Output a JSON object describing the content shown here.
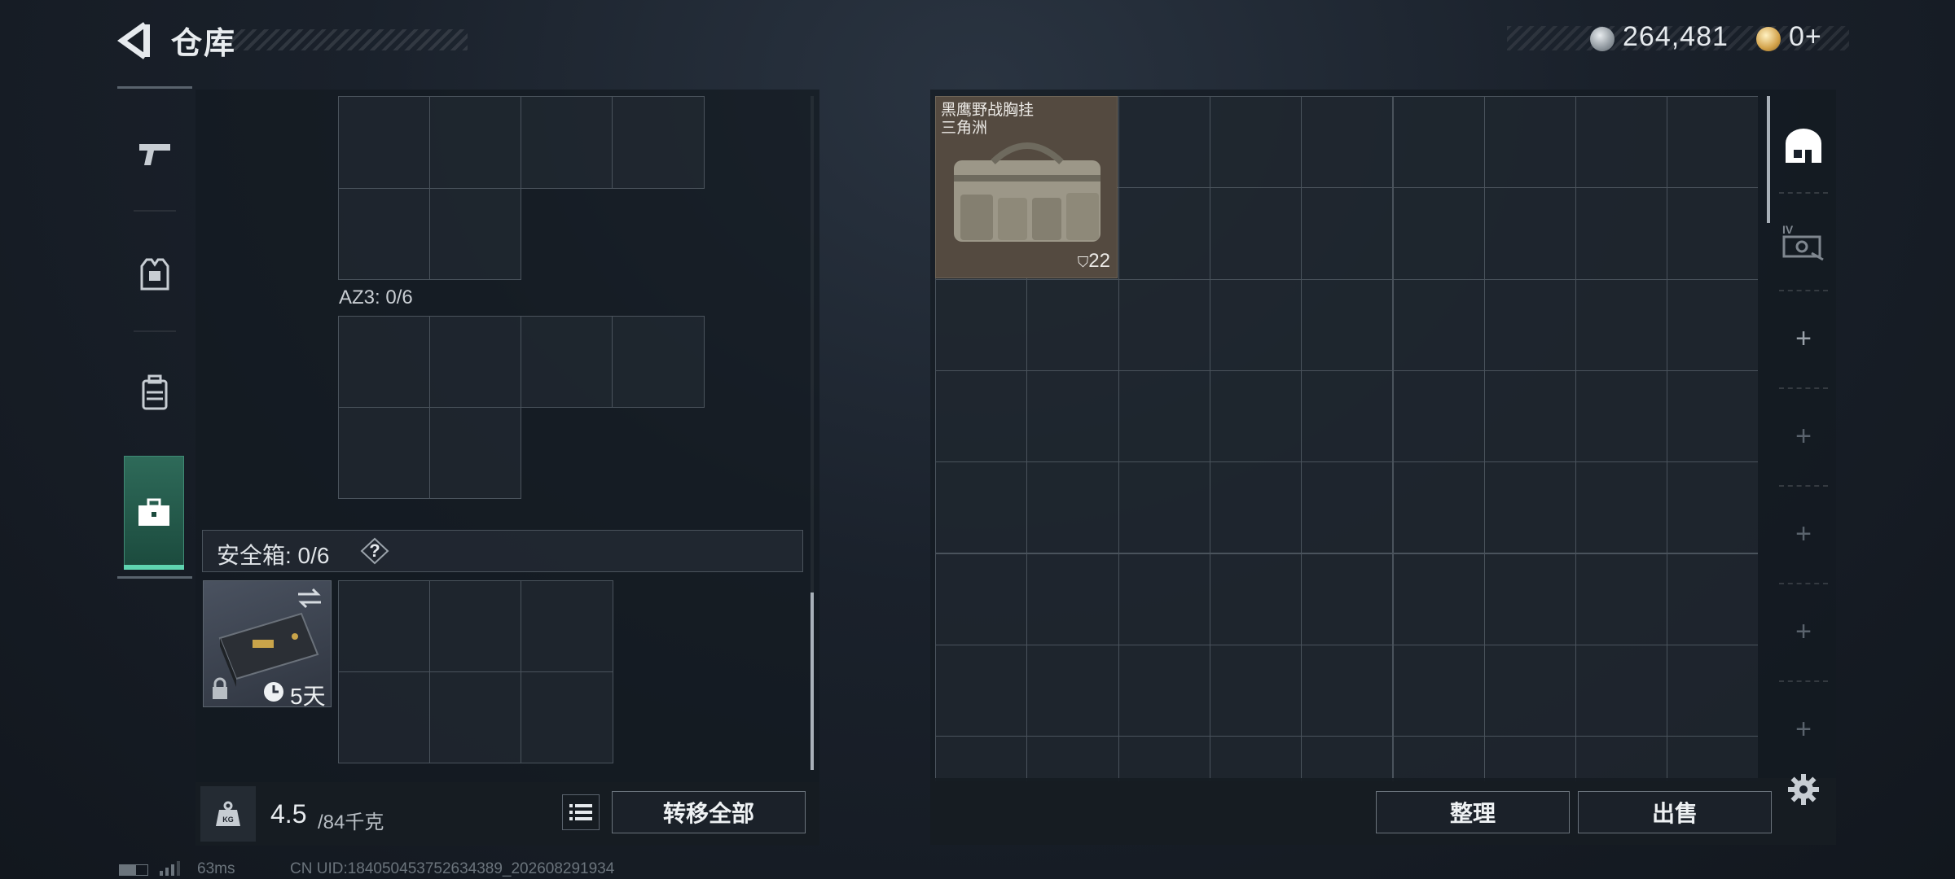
{
  "header": {
    "title": "仓库",
    "back_icon": "back-arrow-icon",
    "currency": {
      "silver_value": "264,481",
      "silver_icon": "silver-coin-icon",
      "gold_value": "0",
      "gold_add": "+",
      "gold_icon": "gold-coin-icon"
    }
  },
  "left_tabs": [
    {
      "name": "weapon",
      "icon": "pistol-icon"
    },
    {
      "name": "armor",
      "icon": "armor-vest-icon"
    },
    {
      "name": "backpack",
      "icon": "backpack-icon"
    },
    {
      "name": "safe-case",
      "icon": "briefcase-icon",
      "active": true
    }
  ],
  "loadout": {
    "az3_label": "AZ3: 0/6",
    "safe_box_label": "安全箱: 0/6",
    "safe_box_help": "?",
    "safe_box_item": {
      "days_left": "5天",
      "icons": [
        "swap-icon",
        "lock-icon",
        "clock-icon"
      ]
    }
  },
  "weight": {
    "current": "4.5",
    "max": "/84千克",
    "icon": "kg-weight-icon"
  },
  "actions": {
    "transfer_all": "转移全部",
    "sort": "整理",
    "sell": "出售"
  },
  "stash": {
    "columns": 9,
    "items": [
      {
        "name_line1": "黑鹰野战胸挂",
        "name_line2": "三角洲",
        "count": "22",
        "bg": "#544a40"
      }
    ]
  },
  "right_rail": [
    "rest-icon",
    "case-scan-icon",
    "plus-icon",
    "plus-icon",
    "plus-icon",
    "plus-icon",
    "plus-icon"
  ],
  "footer": {
    "ping": "63ms",
    "uid": "CN UID:184050453752634389_202608291934"
  },
  "colors": {
    "accent_green": "#5fd4b0",
    "gold": "#d2a24a"
  }
}
